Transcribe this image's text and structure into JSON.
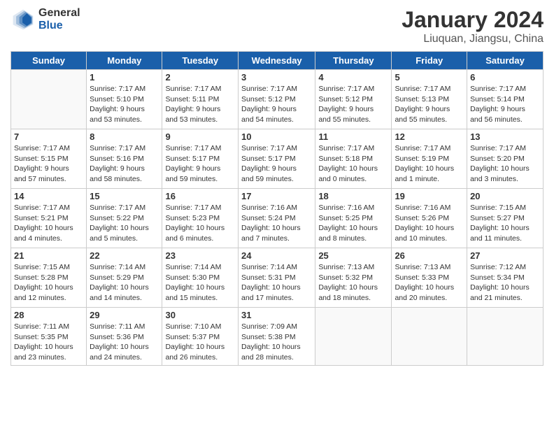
{
  "logo": {
    "general": "General",
    "blue": "Blue"
  },
  "title": "January 2024",
  "subtitle": "Liuquan, Jiangsu, China",
  "headers": [
    "Sunday",
    "Monday",
    "Tuesday",
    "Wednesday",
    "Thursday",
    "Friday",
    "Saturday"
  ],
  "weeks": [
    [
      {
        "day": "",
        "info": ""
      },
      {
        "day": "1",
        "info": "Sunrise: 7:17 AM\nSunset: 5:10 PM\nDaylight: 9 hours\nand 53 minutes."
      },
      {
        "day": "2",
        "info": "Sunrise: 7:17 AM\nSunset: 5:11 PM\nDaylight: 9 hours\nand 53 minutes."
      },
      {
        "day": "3",
        "info": "Sunrise: 7:17 AM\nSunset: 5:12 PM\nDaylight: 9 hours\nand 54 minutes."
      },
      {
        "day": "4",
        "info": "Sunrise: 7:17 AM\nSunset: 5:12 PM\nDaylight: 9 hours\nand 55 minutes."
      },
      {
        "day": "5",
        "info": "Sunrise: 7:17 AM\nSunset: 5:13 PM\nDaylight: 9 hours\nand 55 minutes."
      },
      {
        "day": "6",
        "info": "Sunrise: 7:17 AM\nSunset: 5:14 PM\nDaylight: 9 hours\nand 56 minutes."
      }
    ],
    [
      {
        "day": "7",
        "info": "Sunrise: 7:17 AM\nSunset: 5:15 PM\nDaylight: 9 hours\nand 57 minutes."
      },
      {
        "day": "8",
        "info": "Sunrise: 7:17 AM\nSunset: 5:16 PM\nDaylight: 9 hours\nand 58 minutes."
      },
      {
        "day": "9",
        "info": "Sunrise: 7:17 AM\nSunset: 5:17 PM\nDaylight: 9 hours\nand 59 minutes."
      },
      {
        "day": "10",
        "info": "Sunrise: 7:17 AM\nSunset: 5:17 PM\nDaylight: 9 hours\nand 59 minutes."
      },
      {
        "day": "11",
        "info": "Sunrise: 7:17 AM\nSunset: 5:18 PM\nDaylight: 10 hours\nand 0 minutes."
      },
      {
        "day": "12",
        "info": "Sunrise: 7:17 AM\nSunset: 5:19 PM\nDaylight: 10 hours\nand 1 minute."
      },
      {
        "day": "13",
        "info": "Sunrise: 7:17 AM\nSunset: 5:20 PM\nDaylight: 10 hours\nand 3 minutes."
      }
    ],
    [
      {
        "day": "14",
        "info": "Sunrise: 7:17 AM\nSunset: 5:21 PM\nDaylight: 10 hours\nand 4 minutes."
      },
      {
        "day": "15",
        "info": "Sunrise: 7:17 AM\nSunset: 5:22 PM\nDaylight: 10 hours\nand 5 minutes."
      },
      {
        "day": "16",
        "info": "Sunrise: 7:17 AM\nSunset: 5:23 PM\nDaylight: 10 hours\nand 6 minutes."
      },
      {
        "day": "17",
        "info": "Sunrise: 7:16 AM\nSunset: 5:24 PM\nDaylight: 10 hours\nand 7 minutes."
      },
      {
        "day": "18",
        "info": "Sunrise: 7:16 AM\nSunset: 5:25 PM\nDaylight: 10 hours\nand 8 minutes."
      },
      {
        "day": "19",
        "info": "Sunrise: 7:16 AM\nSunset: 5:26 PM\nDaylight: 10 hours\nand 10 minutes."
      },
      {
        "day": "20",
        "info": "Sunrise: 7:15 AM\nSunset: 5:27 PM\nDaylight: 10 hours\nand 11 minutes."
      }
    ],
    [
      {
        "day": "21",
        "info": "Sunrise: 7:15 AM\nSunset: 5:28 PM\nDaylight: 10 hours\nand 12 minutes."
      },
      {
        "day": "22",
        "info": "Sunrise: 7:14 AM\nSunset: 5:29 PM\nDaylight: 10 hours\nand 14 minutes."
      },
      {
        "day": "23",
        "info": "Sunrise: 7:14 AM\nSunset: 5:30 PM\nDaylight: 10 hours\nand 15 minutes."
      },
      {
        "day": "24",
        "info": "Sunrise: 7:14 AM\nSunset: 5:31 PM\nDaylight: 10 hours\nand 17 minutes."
      },
      {
        "day": "25",
        "info": "Sunrise: 7:13 AM\nSunset: 5:32 PM\nDaylight: 10 hours\nand 18 minutes."
      },
      {
        "day": "26",
        "info": "Sunrise: 7:13 AM\nSunset: 5:33 PM\nDaylight: 10 hours\nand 20 minutes."
      },
      {
        "day": "27",
        "info": "Sunrise: 7:12 AM\nSunset: 5:34 PM\nDaylight: 10 hours\nand 21 minutes."
      }
    ],
    [
      {
        "day": "28",
        "info": "Sunrise: 7:11 AM\nSunset: 5:35 PM\nDaylight: 10 hours\nand 23 minutes."
      },
      {
        "day": "29",
        "info": "Sunrise: 7:11 AM\nSunset: 5:36 PM\nDaylight: 10 hours\nand 24 minutes."
      },
      {
        "day": "30",
        "info": "Sunrise: 7:10 AM\nSunset: 5:37 PM\nDaylight: 10 hours\nand 26 minutes."
      },
      {
        "day": "31",
        "info": "Sunrise: 7:09 AM\nSunset: 5:38 PM\nDaylight: 10 hours\nand 28 minutes."
      },
      {
        "day": "",
        "info": ""
      },
      {
        "day": "",
        "info": ""
      },
      {
        "day": "",
        "info": ""
      }
    ]
  ]
}
